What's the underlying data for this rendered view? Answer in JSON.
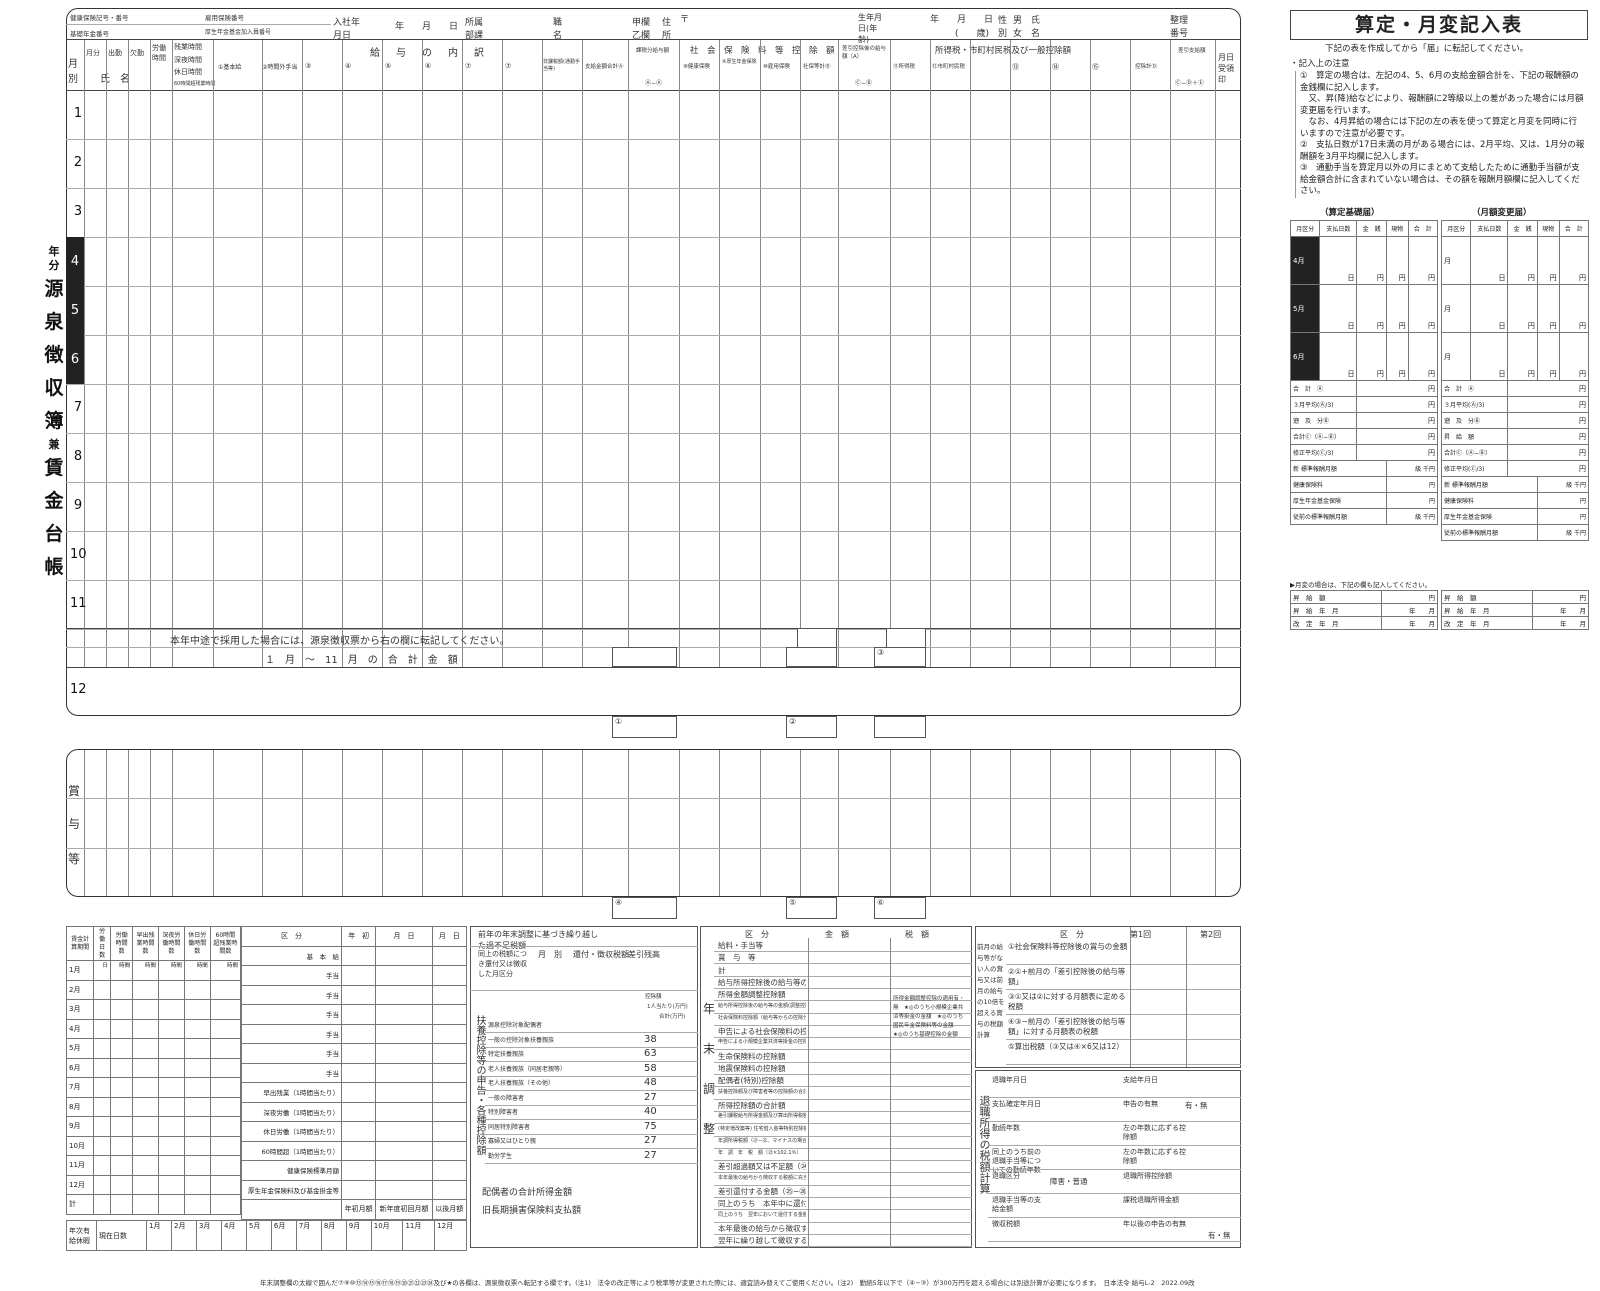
{
  "header": {
    "health_insurance_no": "健康保険記号・番号",
    "employment_insurance_no": "雇用保険番号",
    "pension_no": "基礎年金番号",
    "welfare_pension_no": "厚生年金基金加入員番号",
    "join_date_label": "入社年月日",
    "ymd": "年　　月　　日",
    "department_label": "所属部課",
    "position_label": "職名",
    "kou_otsu_label": "甲欄乙欄",
    "address_label": "住所",
    "postal_mark": "〒",
    "birth_label": "生年月日(年齢)",
    "birth_value": "年　　月　　日",
    "age_value": "(　　歳)",
    "gender_label": "性別",
    "gender_value": "男女",
    "name_label": "氏名",
    "ref_no_label": "整理番号"
  },
  "columns": {
    "month": "月別",
    "month_days": "月分",
    "attend": "出勤",
    "absent": "欠勤",
    "labor_hours": "労働時間",
    "overtime": "残業時間",
    "night": "深夜時間",
    "holiday": "休日時間",
    "over60": "60時間超残業時間",
    "name": "氏　名",
    "salary_detail": "給　与　の　内　訳",
    "basic": "①基本給",
    "overtime_pay": "②時間外手当",
    "c3": "③",
    "c4": "④",
    "c5": "⑤",
    "c6": "⑥",
    "c7": "⑦",
    "nontax": "非課税額(通勤手当等)",
    "total_pay": "支給金額合計Ⓐ",
    "taxable_pay": "課税分給与額",
    "social_ins": "社　会　保　険　料　等　控　除　額",
    "health": "⑧健康保険",
    "pension": "⑨厚生年金保険",
    "emp_ins": "⑩雇用保険",
    "social_total": "社保等計Ⓑ",
    "after_social": "差引控除後の給与額（A）",
    "tax_deduct": "所得税・市町村民税及び一般控除額",
    "income_tax": "⑪所得税",
    "resident_tax": "⑫市町村民税",
    "c13": "⑬",
    "c14": "⑭",
    "c15": "⑮",
    "deduct_total": "控除計Ⓓ",
    "net_pay": "差引支給額",
    "receive_date": "月日受領印",
    "formula1": "Ⓐ−Ⓐ",
    "formula2": "Ⓒ−Ⓑ",
    "formula3": "Ⓒ−Ⓓ＋Ⓔ"
  },
  "months": [
    "1",
    "2",
    "3",
    "4",
    "5",
    "6",
    "7",
    "8",
    "9",
    "10",
    "11",
    "12"
  ],
  "title_vertical": [
    "年",
    "分",
    "源",
    "泉",
    "徴",
    "収",
    "簿",
    "兼",
    "賃",
    "金",
    "台",
    "帳"
  ],
  "midyear_note": "本年中途で採用した場合には、源泉徴収票から右の欄に転記してください。",
  "jan_nov_total": "１　月　〜　11　月　の　合　計　金　額",
  "bonus_label": [
    "賞",
    "与",
    "等"
  ],
  "marks": [
    "①",
    "②",
    "③",
    "④",
    "⑤",
    "⑥"
  ],
  "right": {
    "title": "算定・月変記入表",
    "intro": "下記の表を作成してから「届」に転記してください。",
    "notes_head": "・記入上の注意",
    "notes": [
      "①　算定の場合は、左記の4、5、6月の支給金額合計を、下記の報酬額の金銭欄に記入します。",
      "　又、昇(降)給などにより、報酬額に2等級以上の差があった場合には月額変更届を行います。",
      "　なお、4月昇給の場合には下記の左の表を使って算定と月変を同時に行いますので注意が必要です。",
      "②　支払日数が17日未満の月がある場合には、2月平均、又は、1月分の報酬額を3月平均欄に記入します。",
      "③　通勤手当を算定月以外の月にまとめて支給したために通勤手当額が支給金額合計に含まれていない場合は、その額を報酬月額欄に記入してください。"
    ],
    "left_table_title": "（算定基礎届）",
    "right_table_title": "（月額変更届）",
    "tbl_head": [
      "月区分",
      "支払日数",
      "報酬月額",
      "金　銭",
      "現物",
      "合　計"
    ],
    "months_456": [
      "4月",
      "5月",
      "6月"
    ],
    "day_unit": "日",
    "yen": "円",
    "month_unit": "月",
    "left_rows": [
      "合　計　Ⓐ",
      "３月平均(Ⓐ/3)",
      "遡　及　分Ⓑ",
      "合計Ⓒ（Ⓐ−Ⓑ）",
      "修正平均(Ⓒ/3)"
    ],
    "right_rows": [
      "合　計　Ⓐ",
      "３月平均(Ⓐ/3)",
      "遡　及　分Ⓑ",
      "昇　給　額",
      "合計Ⓒ（Ⓐ−Ⓑ）",
      "修正平均(Ⓒ/3)"
    ],
    "new_label": "新",
    "kai_label": "改定",
    "std_salary": "標準報酬月額",
    "grade": "級",
    "thousand_yen": "千円",
    "health_ins": "健康保険料",
    "pension_ins": "厚生年金基金保険",
    "prev_std": "従前の標準報酬月額",
    "gappen_note": "▶月変の場合は、下記の欄も記入してください。",
    "raise_amount": "昇　給　額",
    "raise_month": "昇　給　年　月",
    "revise_month": "改　定　年　月",
    "year_month": "年　　月"
  },
  "bottom": {
    "calc_head": [
      "賃金計算期間",
      "労働日数",
      "労働時間数",
      "早出残業時間数",
      "深夜労働時間数",
      "休日労働時間数",
      "60時間超残業時間数"
    ],
    "units": [
      "日",
      "時間",
      "時間",
      "時間",
      "時間",
      "時間"
    ],
    "months": [
      "1月",
      "2月",
      "3月",
      "4月",
      "5月",
      "6月",
      "7月",
      "8月",
      "9月",
      "10月",
      "11月",
      "12月",
      "計"
    ],
    "kubun": "区　分",
    "nensho": "年　初",
    "ymd": "月　日",
    "basic_salary": "基　本　給",
    "allowance": "手当",
    "base_calc": "給与額算定の基礎額",
    "early_ot": "早出残業（1時間当たり）",
    "night_labor": "深夜労働（1時間当たり）",
    "holiday_labor": "休日労働（1時間当たり）",
    "over60": "60時間超（1時間当たり）",
    "health_std": "健康保険標準月額",
    "pension_std": "厚生年金保険料及び基金掛金等",
    "table_labels": [
      "年初月額",
      "新年度初回月額",
      "以後月額"
    ],
    "paid_leave": "年次有給休暇",
    "current_days": "現在日数",
    "paid_months": [
      "1月",
      "2月",
      "3月",
      "4月",
      "5月",
      "6月",
      "7月",
      "8月",
      "9月",
      "10月",
      "11月",
      "12月"
    ],
    "prev_adj": "前年の年末調整に基づき繰り越した過不足税額",
    "refund_head": [
      "同上の税額につき還付又は徴収した月区分",
      "月　別",
      "還付・徴収税額",
      "差引残高"
    ],
    "dependent_title": "扶養控除等の申告・各種控除額",
    "dep_rows": [
      {
        "label": "源泉控除対象配偶者",
        "val": ""
      },
      {
        "label": "一般の控除対象扶養親族",
        "val": "38"
      },
      {
        "label": "特定扶養親族",
        "val": "63"
      },
      {
        "label": "老人扶養親族（同居老親等）",
        "val": "58"
      },
      {
        "label": "老人扶養親族（その他）",
        "val": "48"
      },
      {
        "label": "一般の障害者",
        "val": "27"
      },
      {
        "label": "特別障害者",
        "val": "40"
      },
      {
        "label": "同居特別障害者",
        "val": "75"
      },
      {
        "label": "寡婦又はひとり親",
        "val": "27"
      },
      {
        "label": "勤労学生",
        "val": "27"
      }
    ],
    "dep_head": [
      "控除額",
      "1人当たり(万円)",
      "合計(万円)"
    ],
    "spouse_income": "配偶者の合計所得金額",
    "old_ltc": "旧長期損害保険料支払額",
    "ye_title": [
      "年",
      "末",
      "調",
      "整"
    ],
    "ye_head": [
      "区　分",
      "金　額",
      "税　額"
    ],
    "ye_rows": [
      "給料・手当等",
      "賞　与　等",
      "計",
      "給与所得控除後の給与等の金額",
      "所得金額調整控除額",
      "給与所得控除後の給与等の金額(調整控除後)",
      "社会保険料控除額（給与等からの控除分）",
      "申告による社会保険料の控除分",
      "申告による小規模企業共済等掛金の控除分",
      "生命保険料の控除額",
      "地震保険料の控除額",
      "配偶者(特別)控除額",
      "扶養控除額及び障害者等の控除額の合計額",
      "所得控除額の合計額",
      "差引課税給与所得金額及び算出所得税額",
      "(特定増改築等) 住宅借入金等特別控除額",
      "年調所得税額（㉑−㉒、マイナスの場合は0）",
      "年　調　年　税　額（㉓×102.1％）",
      "差引超過額又は不足額（㉔−⑧）",
      "本年最後の給与から徴収する税額に充当する金額",
      "差引還付する金額（㉕−㉖）",
      "同上のうち　本年中に還付する金額",
      "同上のうち　翌年において還付する金額",
      "本年最後の給与から徴収する金額",
      "翌年に繰り越して徴収する金額"
    ],
    "tax_notes": "所得金額調整控除の適用有・無　★◎のうち小規模企業共済等掛金の金額　★◎のうち国民年金保険料等の金額　★◎のうち基礎控除の金額",
    "bonus_tax_title": "前月の給与等がない人の賞与又は前月の給与の10倍を超える賞与の税額計算",
    "bonus_rows": [
      "①社会保険料等控除後の賞与の金額",
      "②①+前月の「差引控除後の給与等額」",
      "③①又は②に対する月額表に定める税額",
      "④③−前月の「差引控除後の給与等額」に対する月額表の税額",
      "⑤算出税額（③又は④×6又は12）"
    ],
    "bonus_head": [
      "区　分",
      "第1回",
      "第2回"
    ],
    "retire_title": "退職所得の税額計算",
    "retire_rows": [
      "退職年月日",
      "支払確定年月日",
      "勤続年数",
      "同上のうち前の退職手当等についての勤続年数",
      "退職区分",
      "退職手当等の支給金額",
      "徴収税額"
    ],
    "retire_right": [
      "支給年月日",
      "申告の有無",
      "左の年数に応ずる控除額",
      "左の年数に応ずる控除額",
      "退職所得控除額",
      "課税退職所得金額",
      "年以後の申告の有無"
    ],
    "shougai": "障害・普通",
    "umu": "有・無"
  },
  "footer": "年末調整欄の太線で囲んだ⑦⑨⑩⑬⑭⑮⑯⑰⑱⑲⑳㉑㉒㉓㉔及び★の各欄は、源泉徴収票へ転記する欄です。(注1)　法令の改正等により税率等が変更された際には、適宜読み替えてご使用ください。(注2)　勤続5年以下で（④−③）が300万円を超える場合には別途計算が必要になります。　日本法令 給与L-2　2022.09改"
}
